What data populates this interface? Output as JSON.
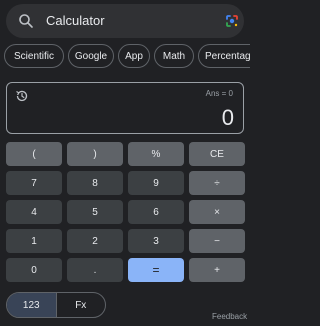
{
  "search": {
    "query": "Calculator"
  },
  "chips": [
    {
      "label": "Scientific"
    },
    {
      "label": "Google"
    },
    {
      "label": "App"
    },
    {
      "label": "Math"
    },
    {
      "label": "Percentage"
    }
  ],
  "display": {
    "ans": "Ans = 0",
    "result": "0"
  },
  "keys": [
    {
      "label": "(",
      "kind": "fn"
    },
    {
      "label": ")",
      "kind": "fn"
    },
    {
      "label": "%",
      "kind": "fn"
    },
    {
      "label": "CE",
      "kind": "fn"
    },
    {
      "label": "7",
      "kind": "num"
    },
    {
      "label": "8",
      "kind": "num"
    },
    {
      "label": "9",
      "kind": "num"
    },
    {
      "label": "÷",
      "kind": "fn"
    },
    {
      "label": "4",
      "kind": "num"
    },
    {
      "label": "5",
      "kind": "num"
    },
    {
      "label": "6",
      "kind": "num"
    },
    {
      "label": "×",
      "kind": "fn"
    },
    {
      "label": "1",
      "kind": "num"
    },
    {
      "label": "2",
      "kind": "num"
    },
    {
      "label": "3",
      "kind": "num"
    },
    {
      "label": "−",
      "kind": "fn"
    },
    {
      "label": "0",
      "kind": "num"
    },
    {
      "label": ".",
      "kind": "num"
    },
    {
      "label": "=",
      "kind": "eq"
    },
    {
      "label": "+",
      "kind": "fn"
    }
  ],
  "mode": {
    "basic": "123",
    "functions": "Fx",
    "active": "123"
  },
  "footer": {
    "feedback": "Feedback"
  },
  "colors": {
    "background": "#202124",
    "key_number": "#3c4043",
    "key_function": "#5f6368",
    "key_equals": "#8ab4f8"
  }
}
